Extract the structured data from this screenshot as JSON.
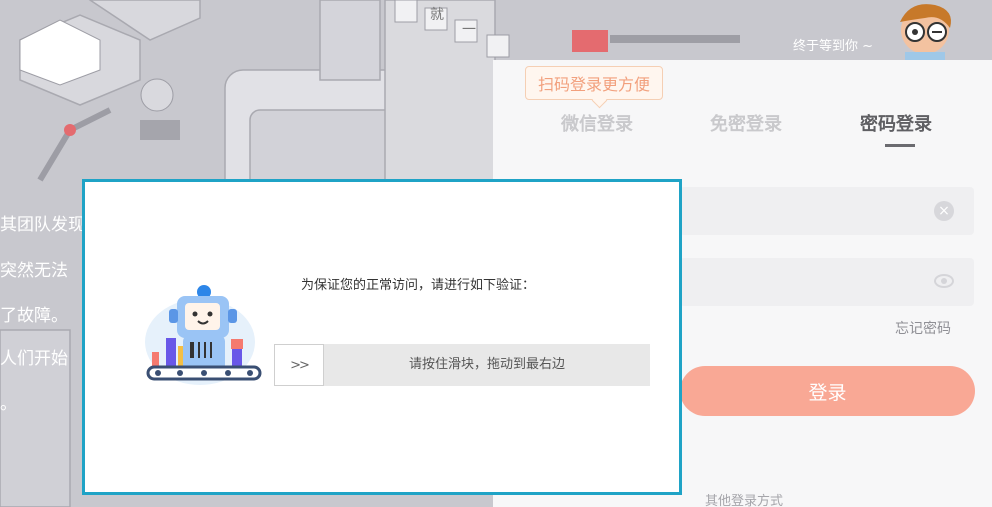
{
  "background": {
    "text_lines": [
      "其团队发现",
      "突然无法",
      "了故障。",
      "人们开始",
      "。"
    ],
    "sign_chars": [
      "就",
      "一"
    ]
  },
  "header": {
    "greeting": "终于等到你 ~"
  },
  "login": {
    "qr_tip": "扫码登录更方便",
    "tabs": [
      {
        "label": "微信登录",
        "active": false
      },
      {
        "label": "免密登录",
        "active": false
      },
      {
        "label": "密码登录",
        "active": true
      }
    ],
    "clear_icon": "×",
    "forgot_password": "忘记密码",
    "login_button": "登录",
    "other_login": "其他登录方式"
  },
  "captcha": {
    "title": "为保证您的正常访问，请进行如下验证：",
    "slider_handle": ">>",
    "slider_text": "请按住滑块，拖动到最右边",
    "progress_color": "#7ac142",
    "border_color": "#1fa3c6"
  }
}
